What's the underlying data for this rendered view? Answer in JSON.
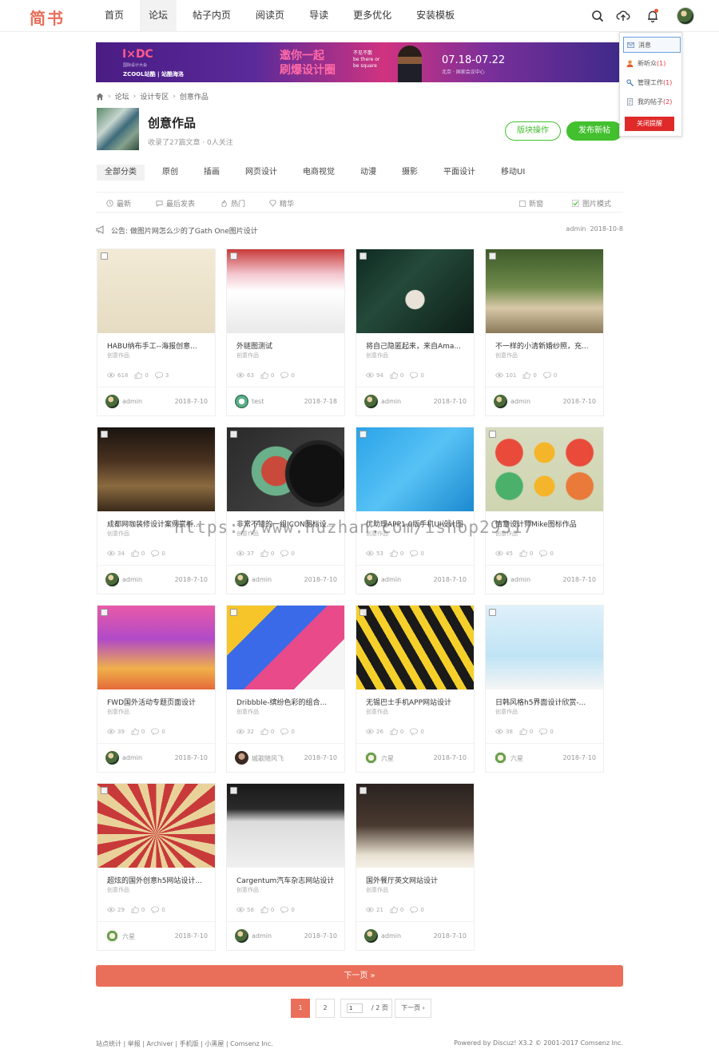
{
  "header": {
    "logo": "简书",
    "nav": [
      "首页",
      "论坛",
      "帖子内页",
      "阅读页",
      "导读",
      "更多优化",
      "安装模板"
    ],
    "active_nav": 1
  },
  "popup": {
    "items": [
      {
        "label": "消息",
        "count": ""
      },
      {
        "label": "新听众",
        "count": "(1)"
      },
      {
        "label": "管理工作",
        "count": "(1)"
      },
      {
        "label": "我的帖子",
        "count": "(2)"
      }
    ],
    "close_label": "关闭提醒"
  },
  "banner": {
    "brand": "I×DC",
    "brand_sub": "国际设计大会",
    "partners": "ZCOOL站酷 | 站酷海洛",
    "slogan_1": "邀你一起",
    "slogan_2": "刷爆设计圈",
    "tag": "不见不散",
    "tag_sub": "be there or be square",
    "date": "07.18-07.22",
    "venue": "北京 · 国家会议中心"
  },
  "breadcrumb": [
    "论坛",
    "设计专区",
    "创意作品"
  ],
  "forum": {
    "title": "创意作品",
    "subtitle": "收录了27篇文章 · 0人关注",
    "manage_label": "版块操作",
    "post_label": "发布新帖"
  },
  "categories": [
    "全部分类",
    "原创",
    "插画",
    "网页设计",
    "电商视觉",
    "动漫",
    "摄影",
    "平面设计",
    "移动UI"
  ],
  "filters": {
    "left": [
      "最新",
      "最后发表",
      "热门",
      "精华"
    ],
    "new_window": "新窗",
    "image_mode": "图片模式"
  },
  "notice": {
    "text": "公告: 做图片网怎么少的了Gath One图片设计",
    "author": "admin",
    "date": "2018-10-8"
  },
  "cards": [
    {
      "title": "HABU纳布手工--海报创意...",
      "cat": "创意作品",
      "views": "618",
      "likes": "0",
      "replies": "3",
      "user": "admin",
      "date": "2018-7-10",
      "img": "illustration-girl"
    },
    {
      "title": "外链图测试",
      "cat": "创意作品",
      "views": "63",
      "likes": "0",
      "replies": "0",
      "user": "test",
      "date": "2018-7-18",
      "img": "collage-screenshot"
    },
    {
      "title": "将自己隐匿起来，来自Ama...",
      "cat": "创意作品",
      "views": "94",
      "likes": "0",
      "replies": "0",
      "user": "admin",
      "date": "2018-7-10",
      "img": "plants-hands"
    },
    {
      "title": "不一样的小清新婚纱照，充...",
      "cat": "创意作品",
      "views": "101",
      "likes": "0",
      "replies": "0",
      "user": "admin",
      "date": "2018-7-10",
      "img": "wedding-couple"
    },
    {
      "title": "成都网咖装修设计案例赏析...",
      "cat": "创意作品",
      "views": "34",
      "likes": "0",
      "replies": "0",
      "user": "admin",
      "date": "2018-7-10",
      "img": "cafe-interior"
    },
    {
      "title": "非常不错的一组ICON图标设...",
      "cat": "创意作品",
      "views": "37",
      "likes": "0",
      "replies": "0",
      "user": "admin",
      "date": "2018-7-10",
      "img": "vinyl-record"
    },
    {
      "title": "优助理APP1.0版手机UI设计图",
      "cat": "创意作品",
      "views": "53",
      "likes": "0",
      "replies": "0",
      "user": "admin",
      "date": "2018-7-10",
      "img": "phone-ui"
    },
    {
      "title": "情意设计师Mike图标作品",
      "cat": "创意作品",
      "views": "45",
      "likes": "0",
      "replies": "0",
      "user": "admin",
      "date": "2018-7-10",
      "img": "food-icons"
    },
    {
      "title": "FWD国外活动专题页面设计",
      "cat": "创意作品",
      "views": "39",
      "likes": "0",
      "replies": "0",
      "user": "admin",
      "date": "2018-7-10",
      "img": "city-skyline"
    },
    {
      "title": "Dribbble-缤纷色彩的组合...",
      "cat": "创意作品",
      "views": "32",
      "likes": "0",
      "replies": "0",
      "user": "城歌随风飞",
      "date": "2018-7-10",
      "img": "colorful-cards"
    },
    {
      "title": "无锡巴士手机APP网站设计",
      "cat": "创意作品",
      "views": "26",
      "likes": "0",
      "replies": "0",
      "user": "六星",
      "date": "2018-7-10",
      "img": "bus-yellow"
    },
    {
      "title": "日韩风格h5界面设计欣赏-...",
      "cat": "创意作品",
      "views": "38",
      "likes": "0",
      "replies": "0",
      "user": "六星",
      "date": "2018-7-10",
      "img": "drink-girl"
    },
    {
      "title": "超炫的国外创意h5网站设计...",
      "cat": "创意作品",
      "views": "29",
      "likes": "0",
      "replies": "0",
      "user": "六星",
      "date": "2018-7-10",
      "img": "sunburst"
    },
    {
      "title": "Cargentum汽车杂志网站设计",
      "cat": "创意作品",
      "views": "58",
      "likes": "0",
      "replies": "0",
      "user": "admin",
      "date": "2018-7-10",
      "img": "car-magazine"
    },
    {
      "title": "国外餐厅英文网站设计",
      "cat": "创意作品",
      "views": "21",
      "likes": "0",
      "replies": "0",
      "user": "admin",
      "date": "2018-7-10",
      "img": "food-site"
    }
  ],
  "pagination": {
    "next_bar": "下一页 »",
    "pages": [
      "1",
      "2"
    ],
    "current_input": "1",
    "total": "/ 2 页",
    "next_label": "下一页"
  },
  "footer": {
    "links": "站点统计 | 举报 | Archiver | 手机版 | 小黑屋 | Comsenz Inc.",
    "powered": "Powered by Discuz! X3.2 © 2001-2017 Comsenz Inc."
  },
  "watermark": "https://www.huzhan.com/ishop29317",
  "colors": {
    "brand": "#ea6f5a",
    "green": "#42c02e",
    "alert": "#e02a2a"
  }
}
